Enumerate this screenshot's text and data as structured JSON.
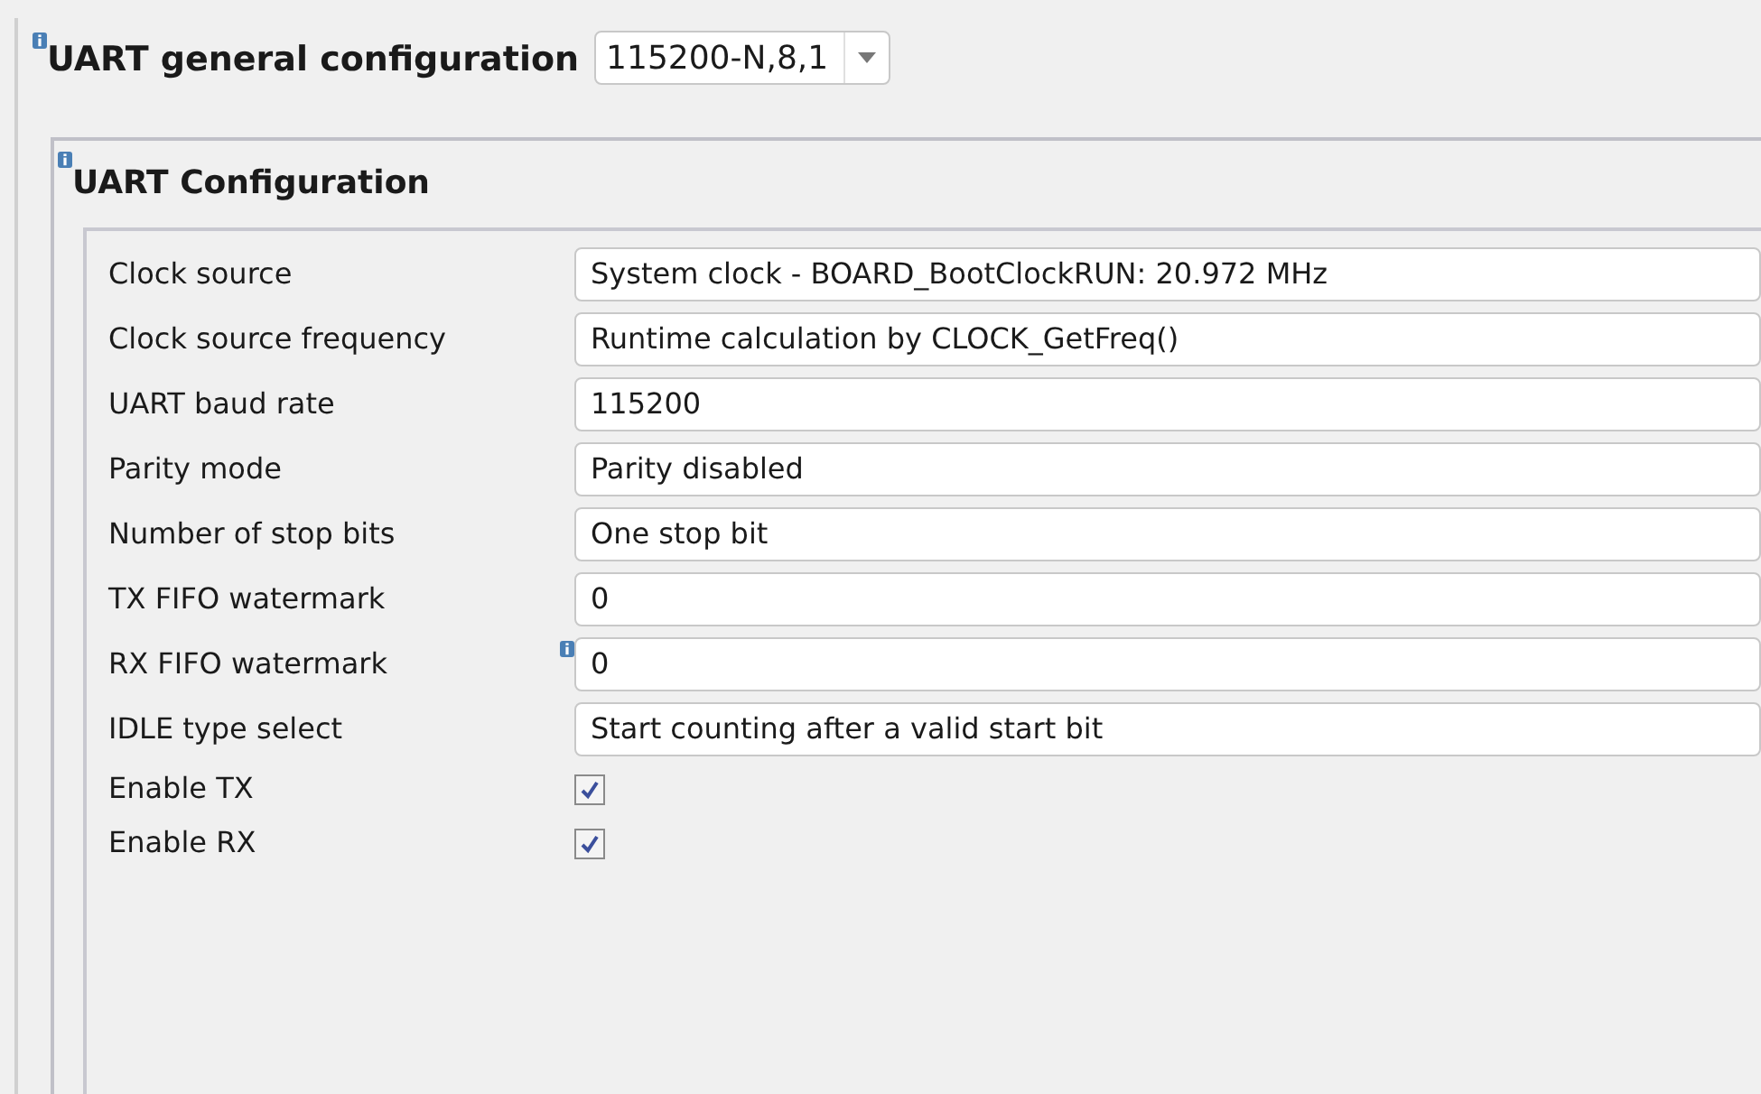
{
  "general": {
    "label": "UART general configuration",
    "value": "115200-N,8,1",
    "info": true
  },
  "section": {
    "title": "UART Configuration",
    "info": true,
    "rows": [
      {
        "kind": "field",
        "label": "Clock source",
        "value": "System clock - BOARD_BootClockRUN: 20.972 MHz",
        "info": false
      },
      {
        "kind": "field",
        "label": "Clock source frequency",
        "value": "Runtime calculation by CLOCK_GetFreq()",
        "info": false
      },
      {
        "kind": "field",
        "label": "UART baud rate",
        "value": "115200",
        "info": false
      },
      {
        "kind": "field",
        "label": "Parity mode",
        "value": "Parity disabled",
        "info": false
      },
      {
        "kind": "field",
        "label": "Number of stop bits",
        "value": "One stop bit",
        "info": false
      },
      {
        "kind": "field",
        "label": "TX FIFO watermark",
        "value": "0",
        "info": false
      },
      {
        "kind": "field",
        "label": "RX FIFO watermark",
        "value": "0",
        "info": true
      },
      {
        "kind": "field",
        "label": "IDLE type select",
        "value": "Start counting after a valid start bit",
        "info": false
      },
      {
        "kind": "checkbox",
        "label": "Enable TX",
        "checked": true
      },
      {
        "kind": "checkbox",
        "label": "Enable RX",
        "checked": true
      }
    ]
  }
}
